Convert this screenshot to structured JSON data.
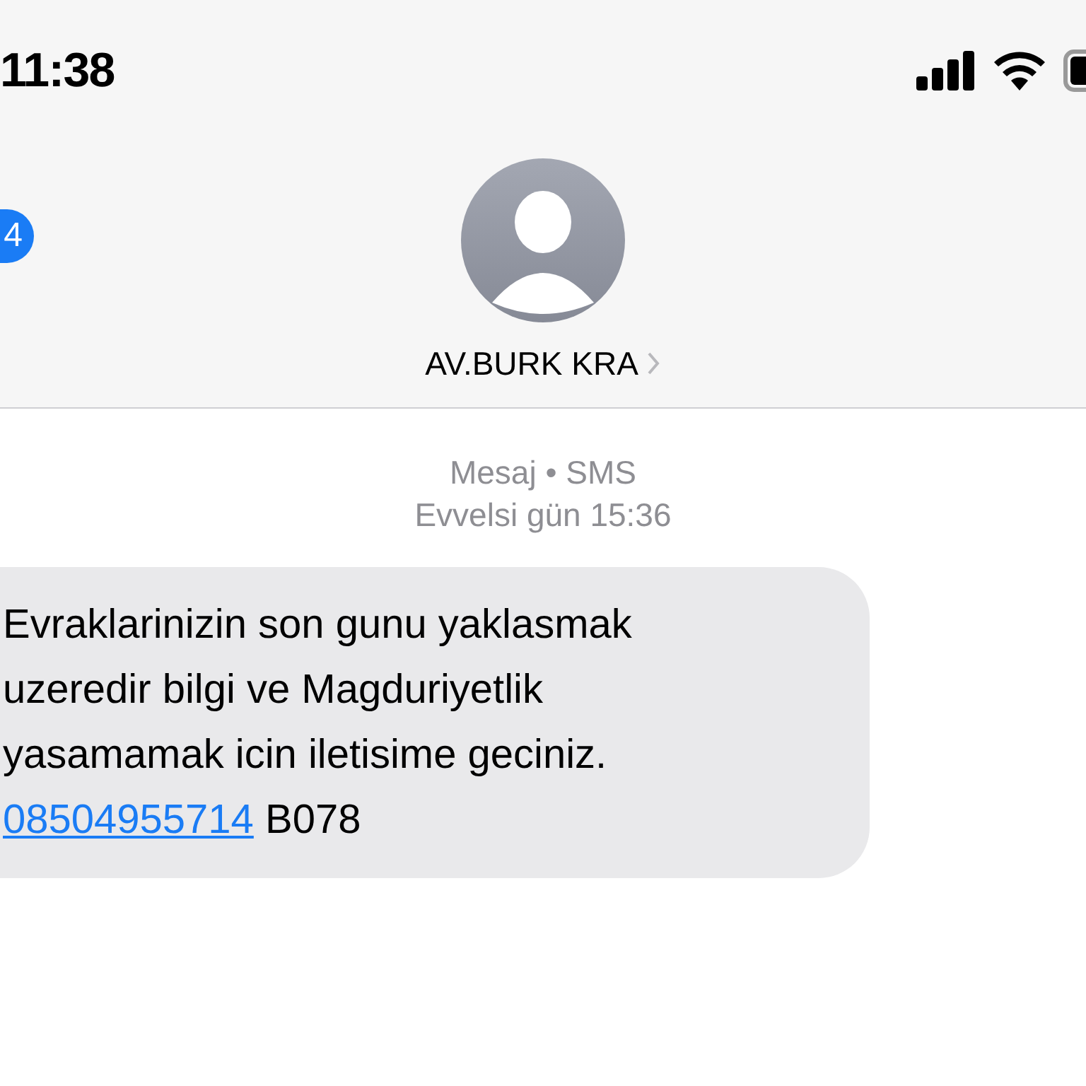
{
  "status_bar": {
    "time": "11:38"
  },
  "header": {
    "back_badge": "4",
    "contact_name": "AV.BURK KRA"
  },
  "conversation": {
    "service": "Mesaj • SMS",
    "timestamp": "Evvelsi gün 15:36",
    "messages": [
      {
        "lines": [
          "Evraklarinizin son gunu yaklasmak",
          "uzeredir bilgi ve Magduriyetlik",
          "yasamamak icin iletisime geciniz."
        ],
        "link": "08504955714",
        "suffix": "B078"
      }
    ]
  }
}
